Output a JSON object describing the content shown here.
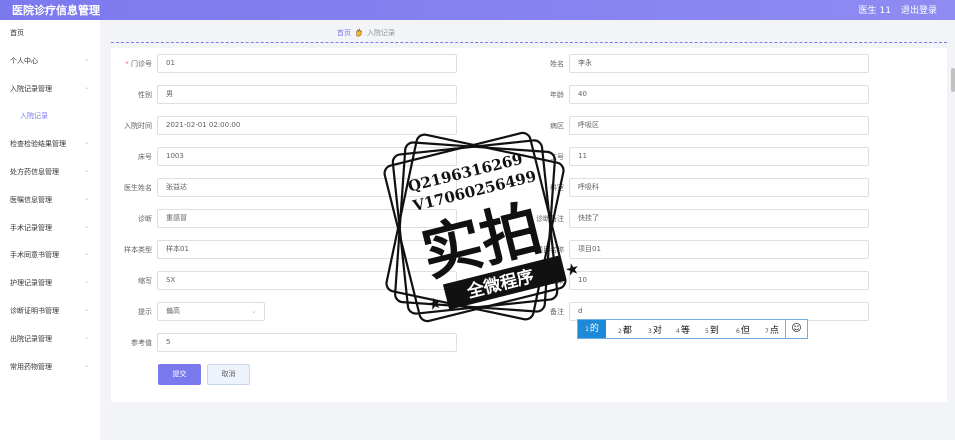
{
  "header": {
    "title": "医院诊疗信息管理",
    "user": "医生 11",
    "logout": "退出登录"
  },
  "sidebar": {
    "items": [
      {
        "label": "首页",
        "chevron": false
      },
      {
        "label": "个人中心",
        "chevron": true
      },
      {
        "label": "入院记录管理",
        "chevron": true
      },
      {
        "label": "入院记录",
        "chevron": false,
        "sub": true
      },
      {
        "label": "检查检验结果管理",
        "chevron": true
      },
      {
        "label": "处方药信息管理",
        "chevron": true
      },
      {
        "label": "医嘱信息管理",
        "chevron": true
      },
      {
        "label": "手术记录管理",
        "chevron": true
      },
      {
        "label": "手术同意书管理",
        "chevron": true
      },
      {
        "label": "护理记录管理",
        "chevron": true
      },
      {
        "label": "诊断证明书管理",
        "chevron": true
      },
      {
        "label": "出院记录管理",
        "chevron": true
      },
      {
        "label": "常用药物管理",
        "chevron": true
      }
    ]
  },
  "breadcrumb": {
    "home": "首页",
    "current": "入院记录"
  },
  "form": {
    "left": [
      {
        "label": "门诊号",
        "required": true,
        "value": "01"
      },
      {
        "label": "性别",
        "value": "男"
      },
      {
        "label": "入院时间",
        "value": "2021-02-01 02:00:00"
      },
      {
        "label": "床号",
        "value": "1003"
      },
      {
        "label": "医生姓名",
        "value": "张益达"
      },
      {
        "label": "诊断",
        "value": "重感冒"
      },
      {
        "label": "样本类型",
        "value": "样本01"
      },
      {
        "label": "缩写",
        "value": "SX"
      },
      {
        "label": "提示",
        "value": "偏高",
        "select": true
      },
      {
        "label": "参考值",
        "value": "5"
      }
    ],
    "right": [
      {
        "label": "姓名",
        "value": "李永"
      },
      {
        "label": "年龄",
        "value": "40"
      },
      {
        "label": "病区",
        "value": "呼吸区"
      },
      {
        "label": "工号",
        "value": "11"
      },
      {
        "label": "科室",
        "value": "呼吸科"
      },
      {
        "label": "诊断备注",
        "value": "快挂了"
      },
      {
        "label": "项目名称",
        "value": "项目01"
      },
      {
        "label": "结果",
        "value": "10"
      },
      {
        "label": "备注",
        "value": "d"
      }
    ],
    "submit": "提交",
    "cancel": "取消"
  },
  "ime": {
    "candidates": [
      {
        "n": "1",
        "t": "的"
      },
      {
        "n": "2",
        "t": "都"
      },
      {
        "n": "3",
        "t": "对"
      },
      {
        "n": "4",
        "t": "等"
      },
      {
        "n": "5",
        "t": "到"
      },
      {
        "n": "6",
        "t": "但"
      },
      {
        "n": "7",
        "t": "点"
      }
    ],
    "emoji": "☺"
  },
  "watermark": {
    "line1": "Q2196316269",
    "line2": "V17060256499",
    "big": "实拍",
    "banner": "全微程序"
  },
  "colors": {
    "accent": "#7b79ee",
    "ime_border": "#70aee6",
    "ime_selected": "#1c8ad6",
    "required": "#f56c6c"
  }
}
